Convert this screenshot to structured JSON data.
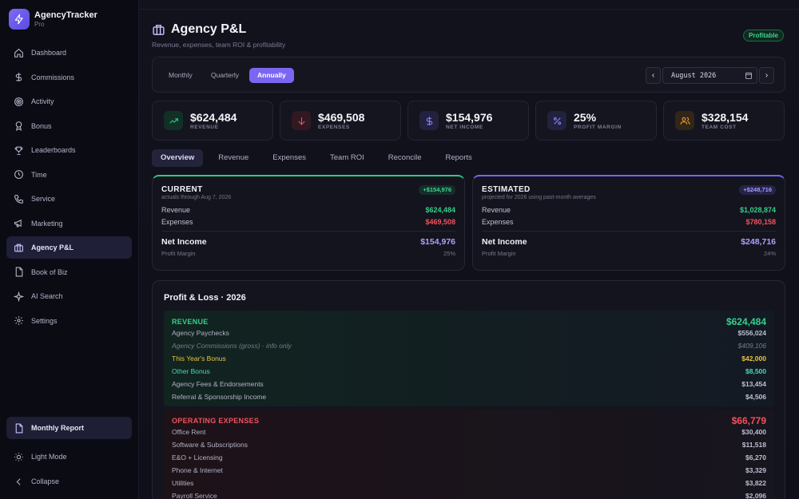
{
  "brand": {
    "name": "AgencyTracker",
    "tier": "Pro"
  },
  "nav": [
    {
      "label": "Dashboard",
      "icon": "home-icon"
    },
    {
      "label": "Commissions",
      "icon": "dollar-icon"
    },
    {
      "label": "Activity",
      "icon": "target-icon"
    },
    {
      "label": "Bonus",
      "icon": "award-icon"
    },
    {
      "label": "Leaderboards",
      "icon": "trophy-icon"
    },
    {
      "label": "Time",
      "icon": "clock-icon"
    },
    {
      "label": "Service",
      "icon": "phone-icon"
    },
    {
      "label": "Marketing",
      "icon": "megaphone-icon"
    },
    {
      "label": "Agency P&L",
      "icon": "briefcase-icon",
      "active": true
    },
    {
      "label": "Book of Biz",
      "icon": "file-icon"
    },
    {
      "label": "AI Search",
      "icon": "sparkle-icon"
    },
    {
      "label": "Settings",
      "icon": "gear-icon"
    }
  ],
  "nav_bottom": {
    "report": "Monthly Report",
    "light": "Light Mode",
    "collapse": "Collapse"
  },
  "page": {
    "title": "Agency P&L",
    "subtitle": "Revenue, expenses, team ROI & profitability",
    "badge": "Profitable"
  },
  "period": {
    "options": [
      "Monthly",
      "Quarterly",
      "Annually"
    ],
    "selected": "Annually",
    "date": "August 2026",
    "prev": "‹",
    "next": "›"
  },
  "stats": [
    {
      "value": "$624,484",
      "label": "REVENUE",
      "color": "#2fc98a"
    },
    {
      "value": "$469,508",
      "label": "EXPENSES",
      "color": "#f0525c"
    },
    {
      "value": "$154,976",
      "label": "NET INCOME",
      "color": "#8b82ff"
    },
    {
      "value": "25%",
      "label": "PROFIT MARGIN",
      "color": "#8b82ff"
    },
    {
      "value": "$328,154",
      "label": "TEAM COST",
      "color": "#f0a030"
    }
  ],
  "tabs": [
    "Overview",
    "Revenue",
    "Expenses",
    "Team ROI",
    "Reconcile",
    "Reports"
  ],
  "current": {
    "title": "CURRENT",
    "sub": "actuals through Aug 7, 2026",
    "badge": "+$154,976",
    "revenue_label": "Revenue",
    "revenue": "$624,484",
    "expenses_label": "Expenses",
    "expenses": "$469,508",
    "net_label": "Net Income",
    "net": "$154,976",
    "margin_label": "Profit Margin",
    "margin": "25%"
  },
  "estimated": {
    "title": "ESTIMATED",
    "sub": "projected for 2026 using past-month averages",
    "badge": "+$248,716",
    "revenue_label": "Revenue",
    "revenue": "$1,028,874",
    "expenses_label": "Expenses",
    "expenses": "$780,158",
    "net_label": "Net Income",
    "net": "$248,716",
    "margin_label": "Profit Margin",
    "margin": "24%"
  },
  "pl": {
    "title": "Profit & Loss · 2026",
    "revenue": {
      "title": "REVENUE",
      "total": "$624,484",
      "lines": [
        {
          "label": "Agency Paychecks",
          "amount": "$556,024"
        },
        {
          "label": "Agency Commissions (gross) · info only",
          "amount": "$409,106"
        },
        {
          "label": "This Year's Bonus",
          "amount": "$42,000"
        },
        {
          "label": "Other Bonus",
          "amount": "$8,500"
        },
        {
          "label": "Agency Fees & Endorsements",
          "amount": "$13,454"
        },
        {
          "label": "Referral & Sponsorship Income",
          "amount": "$4,506"
        }
      ]
    },
    "expenses": {
      "title": "OPERATING EXPENSES",
      "total": "$66,779",
      "lines": [
        {
          "label": "Office Rent",
          "amount": "$30,400"
        },
        {
          "label": "Software & Subscriptions",
          "amount": "$11,518"
        },
        {
          "label": "E&O + Licensing",
          "amount": "$6,270"
        },
        {
          "label": "Phone & Internet",
          "amount": "$3,329"
        },
        {
          "label": "Utilities",
          "amount": "$3,822"
        },
        {
          "label": "Payroll Service",
          "amount": "$2,096"
        }
      ]
    }
  }
}
